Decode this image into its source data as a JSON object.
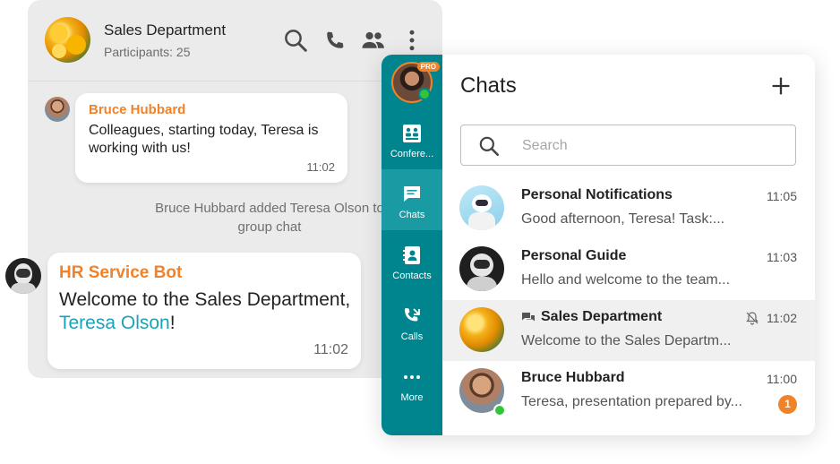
{
  "group_chat": {
    "title": "Sales Department",
    "participants": "Participants: 25",
    "messages": [
      {
        "author": "Bruce Hubbard",
        "text": "Colleagues, starting today, Teresa is working with us!",
        "time": "11:02"
      },
      {
        "author": "HR Service Bot",
        "text_before": "Welcome to the Sales Department, ",
        "mention": "Teresa Olson",
        "text_after": "!",
        "time": "11:02"
      }
    ],
    "system_note": "Bruce Hubbard added Teresa Olson to group chat"
  },
  "sidebar": {
    "badge": "PRO",
    "items": [
      {
        "label": "Confere...",
        "icon": "conference-icon"
      },
      {
        "label": "Chats",
        "icon": "chat-icon"
      },
      {
        "label": "Contacts",
        "icon": "contacts-icon"
      },
      {
        "label": "Calls",
        "icon": "calls-icon"
      },
      {
        "label": "More",
        "icon": "more-icon"
      }
    ],
    "active": "Chats"
  },
  "chats_panel": {
    "title": "Chats",
    "search_placeholder": "Search",
    "rows": [
      {
        "name": "Personal Notifications",
        "time": "11:05",
        "preview": "Good afternoon, Teresa! Task:..."
      },
      {
        "name": "Personal Guide",
        "time": "11:03",
        "preview": "Hello and welcome to the team..."
      },
      {
        "name": "Sales Department",
        "time": "11:02",
        "preview": "Welcome to the Sales Departm...",
        "muted": true,
        "group": true
      },
      {
        "name": "Bruce Hubbard",
        "time": "11:00",
        "preview": "Teresa, presentation prepared by...",
        "unread": "1"
      }
    ]
  },
  "colors": {
    "accent": "#f0822a",
    "rail": "#00848e",
    "link": "#1aa3b5",
    "online": "#31c53a"
  }
}
